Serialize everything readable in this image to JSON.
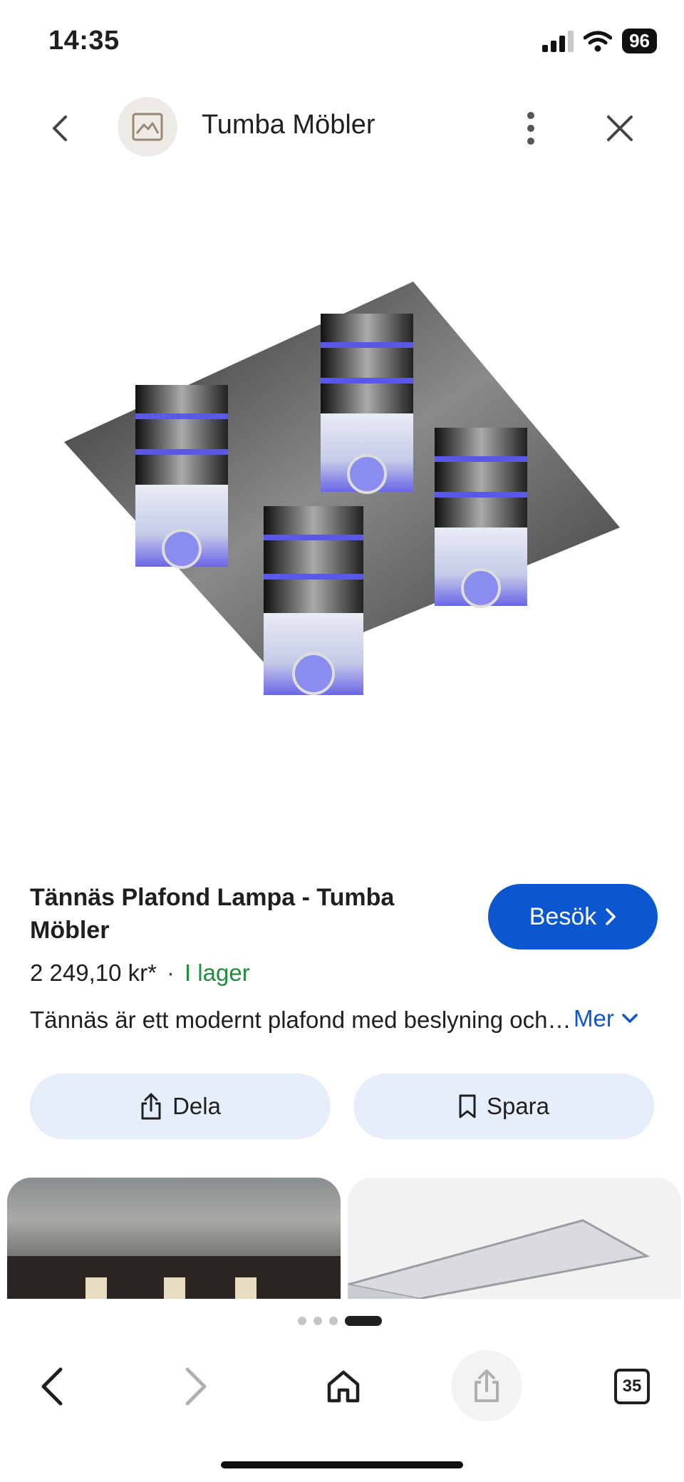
{
  "status_bar": {
    "time": "14:35",
    "battery": "96"
  },
  "header": {
    "title": "Tumba Möbler"
  },
  "product": {
    "title": "Tännäs Plafond Lampa - Tumba Möbler",
    "visit_label": "Besök",
    "price": "2 249,10 kr*",
    "separator": "·",
    "stock": "I lager",
    "description": "Tännäs är ett modernt plafond med beslyning och LED-belysning",
    "more_label": "Mer"
  },
  "actions": {
    "share_label": "Dela",
    "save_label": "Spara"
  },
  "bottom_nav": {
    "tab_count": "35"
  },
  "colors": {
    "accent": "#0b57d0",
    "stock_green": "#1e8e3e",
    "chip_bg": "#e6eefb"
  }
}
